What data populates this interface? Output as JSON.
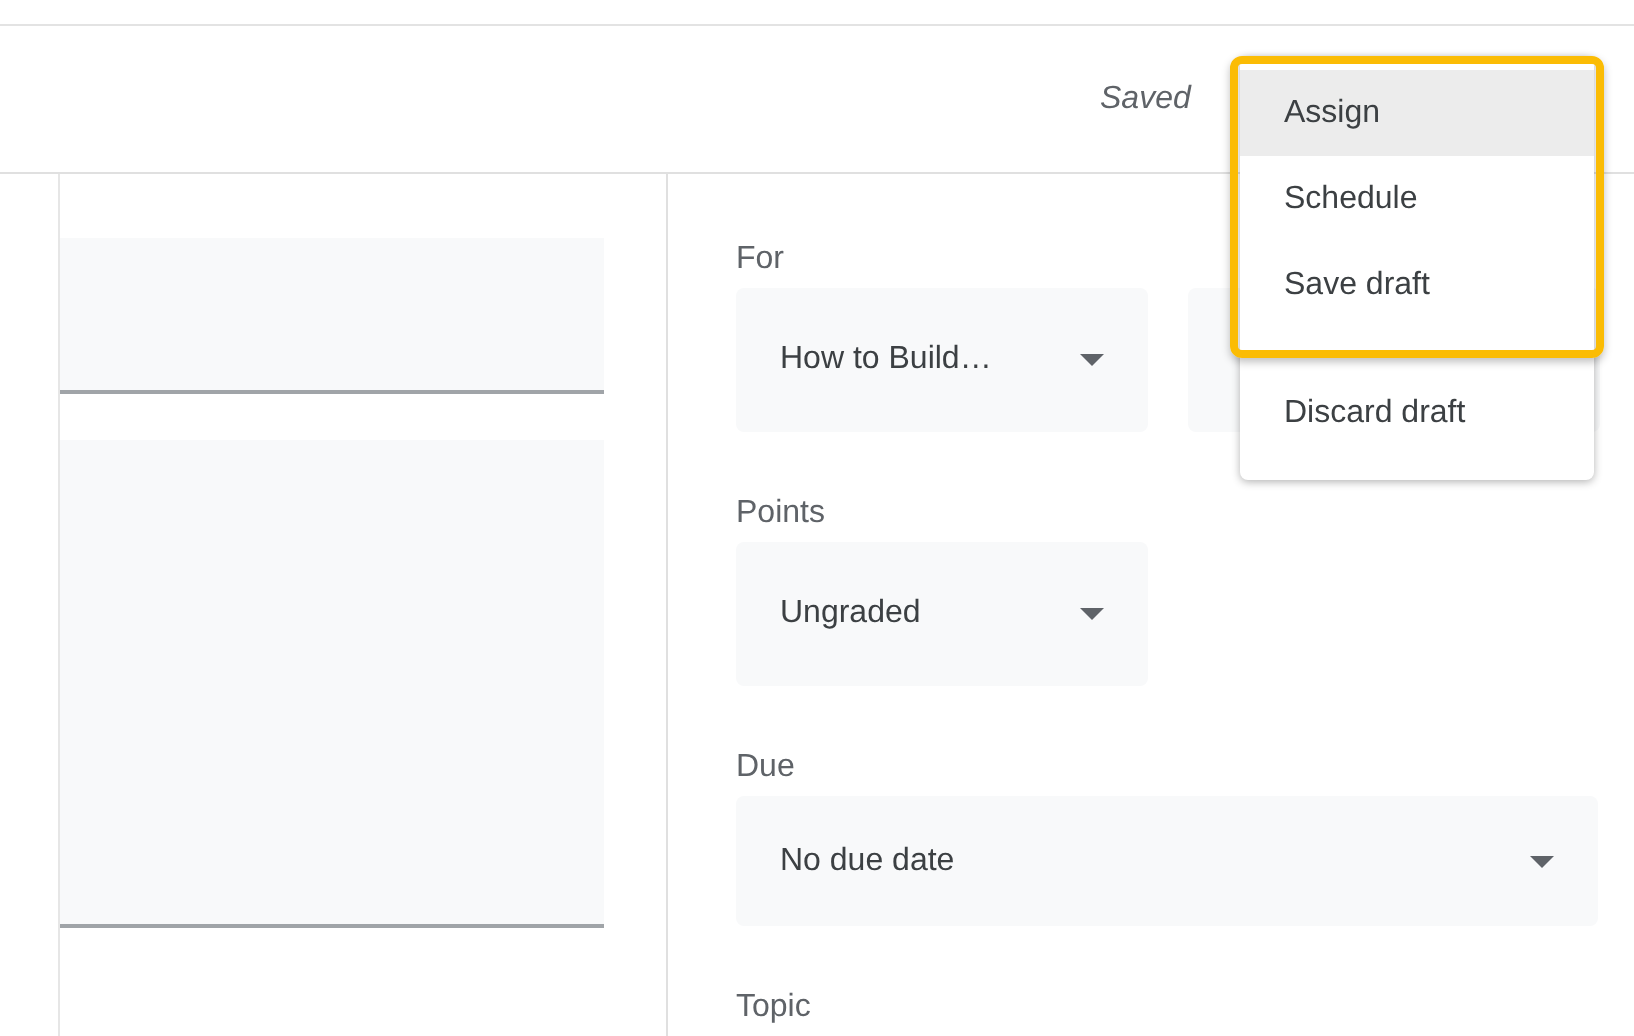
{
  "top_bar": {
    "status": "Saved"
  },
  "settings": [
    {
      "kind": "select",
      "label": "For",
      "selects": [
        {
          "value": "How to Build…",
          "wide": false
        },
        {
          "wide": false
        }
      ]
    },
    {
      "kind": "select",
      "label": "Points",
      "selects": [
        {
          "value": "Ungraded",
          "wide": false
        }
      ]
    },
    {
      "kind": "select",
      "label": "Due",
      "selects": [
        {
          "value": "No due date",
          "wide": true
        }
      ]
    },
    {
      "kind": "heading",
      "label": "Topic"
    }
  ],
  "menu": {
    "groups": [
      {
        "annotated": true,
        "items": [
          {
            "label": "Assign",
            "selected": true
          },
          {
            "label": "Schedule",
            "selected": false
          },
          {
            "label": "Save draft",
            "selected": false
          }
        ]
      },
      {
        "annotated": false,
        "items": [
          {
            "label": "Discard draft",
            "selected": false
          }
        ]
      }
    ]
  }
}
